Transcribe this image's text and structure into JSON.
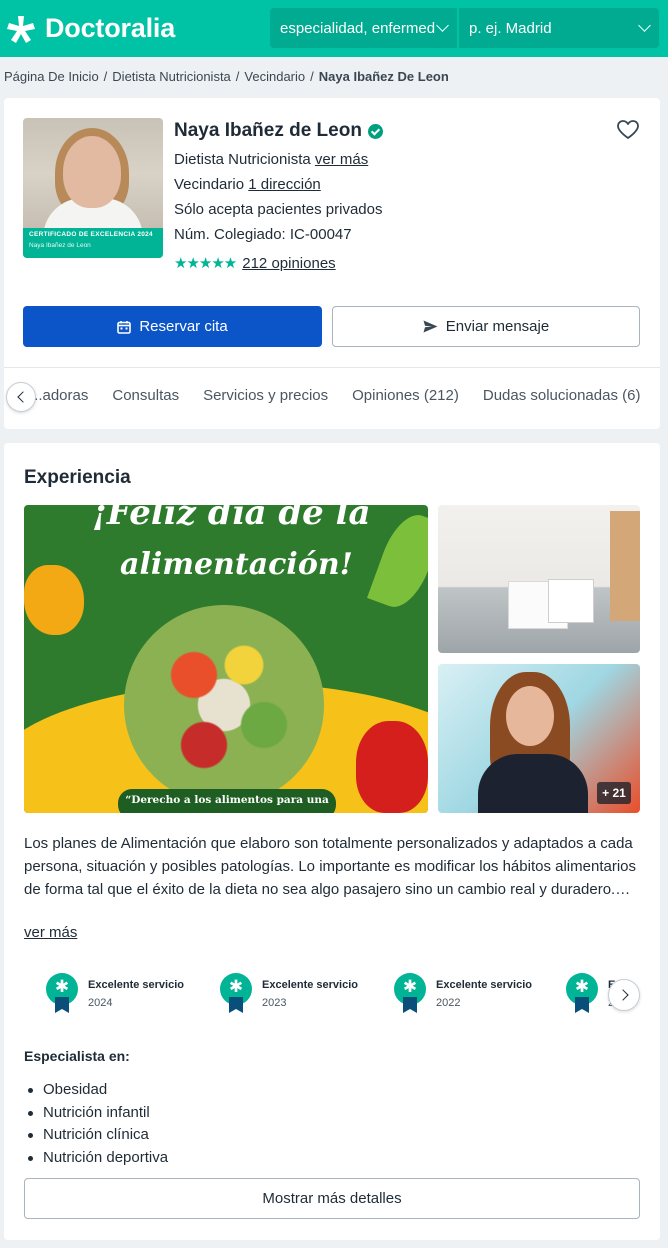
{
  "header": {
    "logo_text": "Doctoralia",
    "specialty_value": "especialidad, enfermed",
    "location_placeholder": "p. ej. Madrid"
  },
  "breadcrumb": {
    "items": [
      "Página De Inicio",
      "Dietista Nutricionista",
      "Vecindario"
    ],
    "current": "Naya Ibañez De Leon"
  },
  "profile": {
    "name": "Naya Ibañez de Leon",
    "photo_cert_title": "CERTIFICADO DE EXCELENCIA 2024",
    "photo_cert_name": "Naya Ibañez de Leon",
    "specialty": "Dietista Nutricionista",
    "see_more": "ver más",
    "location_prefix": "Vecindario",
    "address_link": "1 dirección",
    "private_note": "Sólo acepta pacientes privados",
    "license": "Núm. Colegiado: IC-00047",
    "stars": "★★★★★",
    "reviews_link": "212 opiniones",
    "book_label": "Reservar cita",
    "message_label": "Enviar mensaje"
  },
  "tabs": [
    "...adoras",
    "Consultas",
    "Servicios y precios",
    "Opiniones (212)",
    "Dudas solucionadas (6)"
  ],
  "experience": {
    "title": "Experiencia",
    "image_title_line1": "¡Feliz día de la",
    "image_title_line2": "alimentación!",
    "image_quote": "“Derecho a los alimentos para una",
    "more_photos": "+ 21",
    "description": "Los planes de Alimentación que elaboro son totalmente personalizados y adaptados a cada persona, situación y posibles patologías. Lo importante es modificar los hábitos alimentarios de forma tal que el éxito de la dieta no sea algo pasajero sino un cambio real y duradero.…",
    "see_more": "ver más",
    "awards": [
      {
        "title": "Excelente servicio",
        "year": "2024"
      },
      {
        "title": "Excelente servicio",
        "year": "2023"
      },
      {
        "title": "Excelente servicio",
        "year": "2022"
      },
      {
        "title": "E",
        "year": "2"
      }
    ],
    "specialist_title": "Especialista en:",
    "specialties": [
      "Obesidad",
      "Nutrición infantil",
      "Nutrición clínica",
      "Nutrición deportiva"
    ],
    "details_button": "Mostrar más detalles"
  },
  "colors": {
    "brand": "#00c3a5",
    "primary_button": "#0c55c8",
    "rating": "#00b495"
  }
}
